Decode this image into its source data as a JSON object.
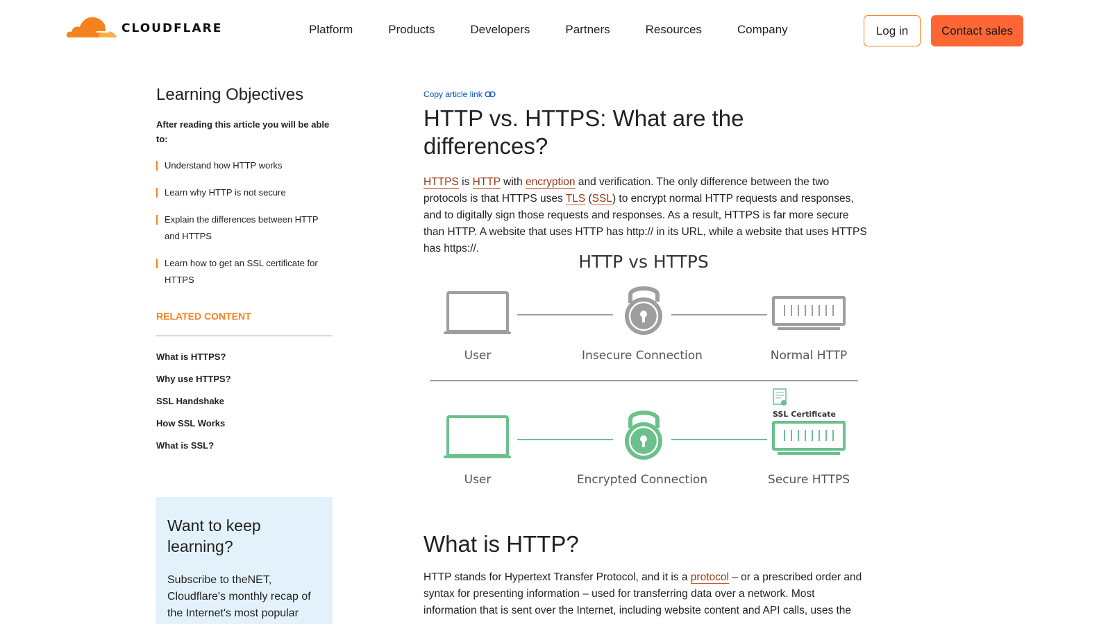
{
  "brand": {
    "name": "CLOUDFLARE",
    "accent": "#f6821f",
    "cta_color": "#ff6633"
  },
  "nav": {
    "items": [
      "Platform",
      "Products",
      "Developers",
      "Partners",
      "Resources",
      "Company"
    ]
  },
  "header_actions": {
    "login": "Log in",
    "contact": "Contact sales"
  },
  "sidebar": {
    "learning_title": "Learning Objectives",
    "learning_intro": "After reading this article you will be able to:",
    "objectives": [
      "Understand how HTTP works",
      "Learn why HTTP is not secure",
      "Explain the differences between HTTP and HTTPS",
      "Learn how to get an SSL certificate for HTTPS"
    ],
    "related_title": "RELATED CONTENT",
    "related": [
      "What is HTTPS?",
      "Why use HTTPS?",
      "SSL Handshake",
      "How SSL Works",
      "What is SSL?"
    ],
    "promo_title": "Want to keep learning?",
    "promo_text": "Subscribe to theNET, Cloudflare's monthly recap of the Internet's most popular"
  },
  "article": {
    "copy_link": "Copy article link",
    "title": "HTTP vs. HTTPS: What are the differences?",
    "intro": {
      "link1": "HTTPS",
      "t1": " is ",
      "link2": "HTTP",
      "t2": " with ",
      "link3": "encryption",
      "t3": " and verification. The only difference between the two protocols is that HTTPS uses ",
      "link4": "TLS",
      "t4": " (",
      "link5": "SSL",
      "t5": ") to encrypt normal HTTP requests and responses, and to digitally sign those requests and responses. As a result, HTTPS is far more secure than HTTP. A website that uses HTTP has http:// in its URL, while a website that uses HTTPS has https://."
    },
    "diagram": {
      "title": "HTTP vs HTTPS",
      "top_row": {
        "left": "User",
        "middle": "Insecure Connection",
        "right": "Normal HTTP"
      },
      "bottom_row": {
        "left": "User",
        "middle": "Encrypted Connection",
        "right": "Secure HTTPS"
      },
      "cert_label": "SSL Certificate",
      "insecure_color": "#9e9e9e",
      "secure_color": "#6bc08c"
    },
    "section2_title": "What is HTTP?",
    "section2": {
      "t1": "HTTP stands for Hypertext Transfer Protocol, and it is a ",
      "link1": "protocol",
      "t2": " – or a prescribed order and syntax for presenting information – used for transferring data over a network. Most information that is sent over the Internet, including website content and API calls, uses the"
    }
  }
}
